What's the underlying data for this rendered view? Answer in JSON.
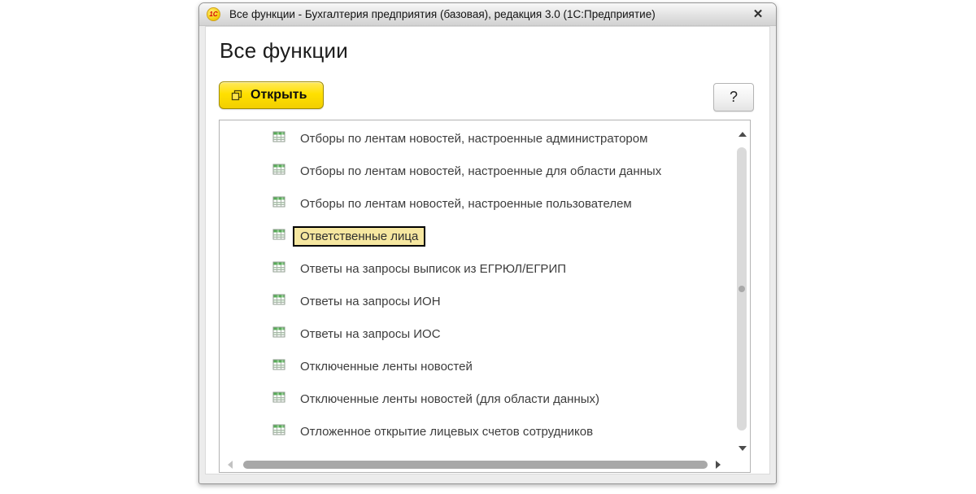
{
  "window": {
    "title": "Все функции - Бухгалтерия предприятия (базовая), редакция 3.0  (1С:Предприятие)",
    "app_icon_text": "1С",
    "close_glyph": "✕"
  },
  "header": {
    "title": "Все функции"
  },
  "toolbar": {
    "open_button_label": "Открыть",
    "help_button_label": "?"
  },
  "list": {
    "selected_index": 3,
    "item_icon": "table-grid-icon",
    "items": [
      {
        "label": "Отборы по лентам новостей, настроенные администратором"
      },
      {
        "label": "Отборы по лентам новостей, настроенные для области данных"
      },
      {
        "label": "Отборы по лентам новостей, настроенные пользователем"
      },
      {
        "label": "Ответственные лица",
        "selected": true
      },
      {
        "label": "Ответы на запросы выписок из ЕГРЮЛ/ЕГРИП"
      },
      {
        "label": "Ответы на запросы ИОН"
      },
      {
        "label": "Ответы на запросы ИОС"
      },
      {
        "label": "Отключенные ленты новостей"
      },
      {
        "label": "Отключенные ленты новостей (для области данных)"
      },
      {
        "label": "Отложенное открытие лицевых счетов сотрудников"
      }
    ]
  },
  "colors": {
    "accent_yellow": "#FFE000",
    "selection_background": "#F6E7A0",
    "selection_border": "#000000",
    "icon_green": "#58AB58",
    "logo_red": "#D50000"
  }
}
